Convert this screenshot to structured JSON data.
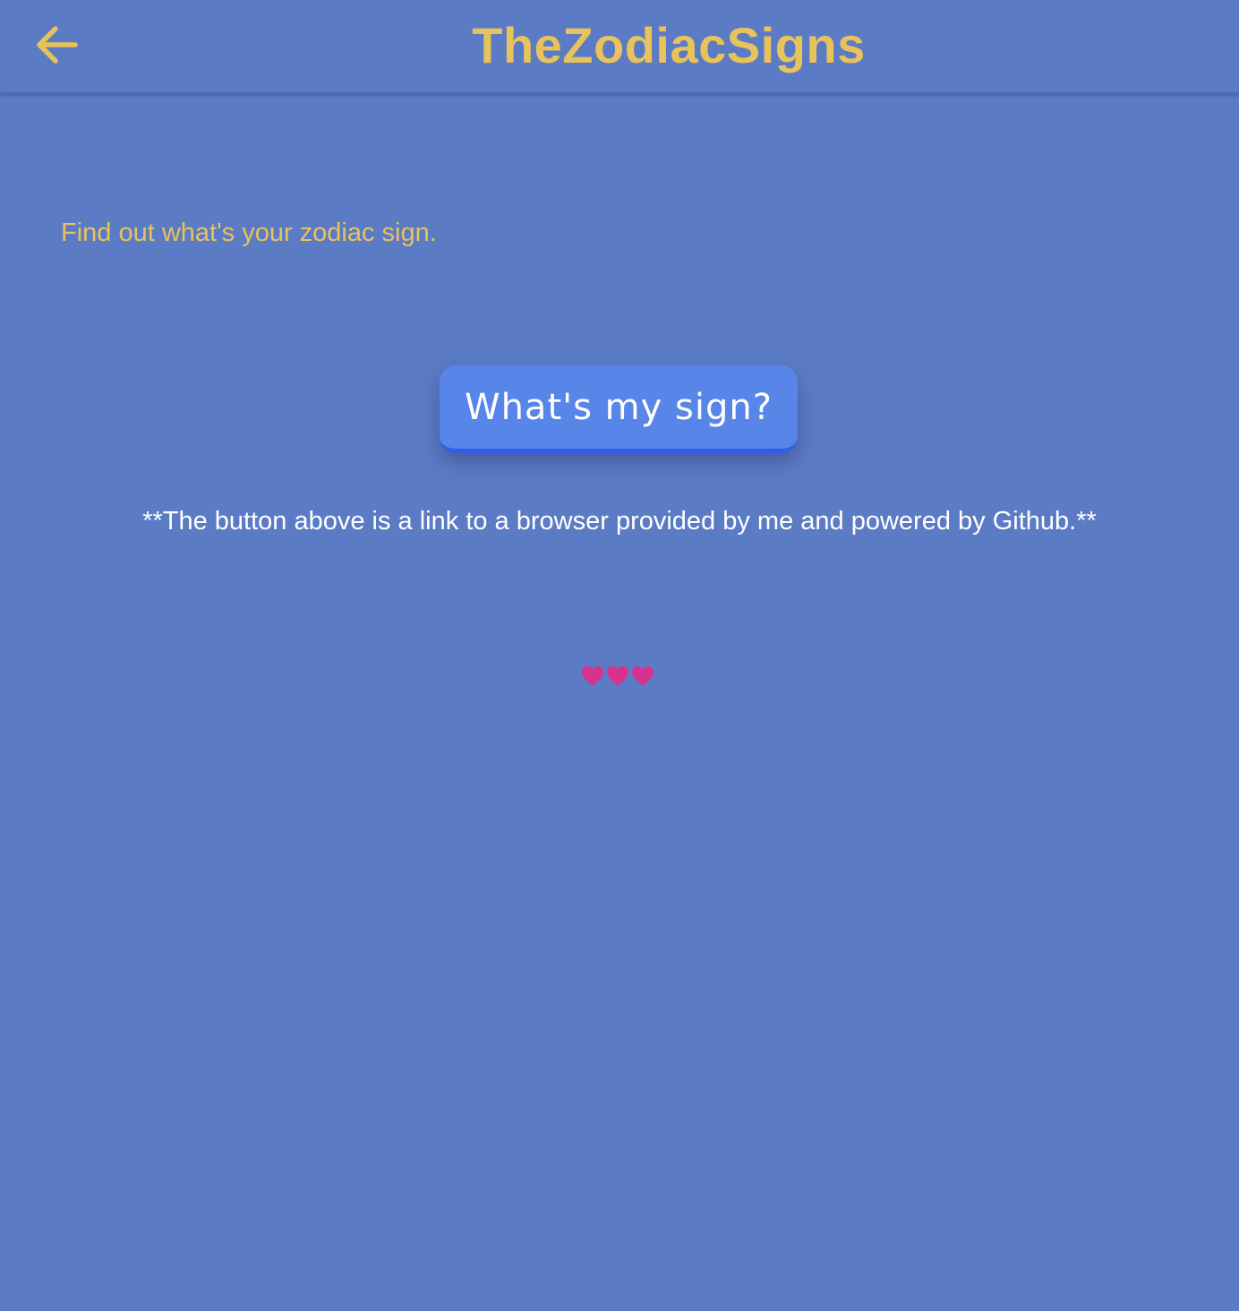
{
  "app_bar": {
    "title": "TheZodiacSigns",
    "back_icon": "arrow-left-icon"
  },
  "main": {
    "intro": "Find out what's your zodiac sign.",
    "sign_button_label": "What's my sign?",
    "note": "**The button above is a link to a browser provided by me and powered by Github.**",
    "hearts_icon": "heart-icon",
    "hearts_count": 3
  },
  "colors": {
    "background": "#5c7bc5",
    "accent": "#e8c25a",
    "button": "#5885e8",
    "heart": "#d6338f"
  }
}
